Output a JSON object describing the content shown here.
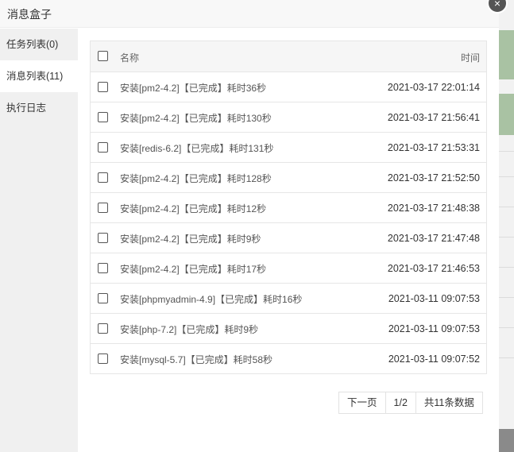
{
  "window": {
    "title": "消息盒子",
    "close_glyph": "×"
  },
  "sidebar": {
    "items": [
      {
        "label": "任务列表(0)"
      },
      {
        "label": "消息列表(11)"
      },
      {
        "label": "执行日志"
      }
    ]
  },
  "table": {
    "columns": {
      "name": "名称",
      "time": "时间"
    },
    "rows": [
      {
        "name": "安装[pm2-4.2]【已完成】耗时36秒",
        "time": "2021-03-17 22:01:14"
      },
      {
        "name": "安装[pm2-4.2]【已完成】耗时130秒",
        "time": "2021-03-17 21:56:41"
      },
      {
        "name": "安装[redis-6.2]【已完成】耗时131秒",
        "time": "2021-03-17 21:53:31"
      },
      {
        "name": "安装[pm2-4.2]【已完成】耗时128秒",
        "time": "2021-03-17 21:52:50"
      },
      {
        "name": "安装[pm2-4.2]【已完成】耗时12秒",
        "time": "2021-03-17 21:48:38"
      },
      {
        "name": "安装[pm2-4.2]【已完成】耗时9秒",
        "time": "2021-03-17 21:47:48"
      },
      {
        "name": "安装[pm2-4.2]【已完成】耗时17秒",
        "time": "2021-03-17 21:46:53"
      },
      {
        "name": "安装[phpmyadmin-4.9]【已完成】耗时16秒",
        "time": "2021-03-11 09:07:53"
      },
      {
        "name": "安装[php-7.2]【已完成】耗时9秒",
        "time": "2021-03-11 09:07:53"
      },
      {
        "name": "安装[mysql-5.7]【已完成】耗时58秒",
        "time": "2021-03-11 09:07:52"
      }
    ]
  },
  "pager": {
    "next": "下一页",
    "page": "1/2",
    "total": "共11条数据"
  }
}
